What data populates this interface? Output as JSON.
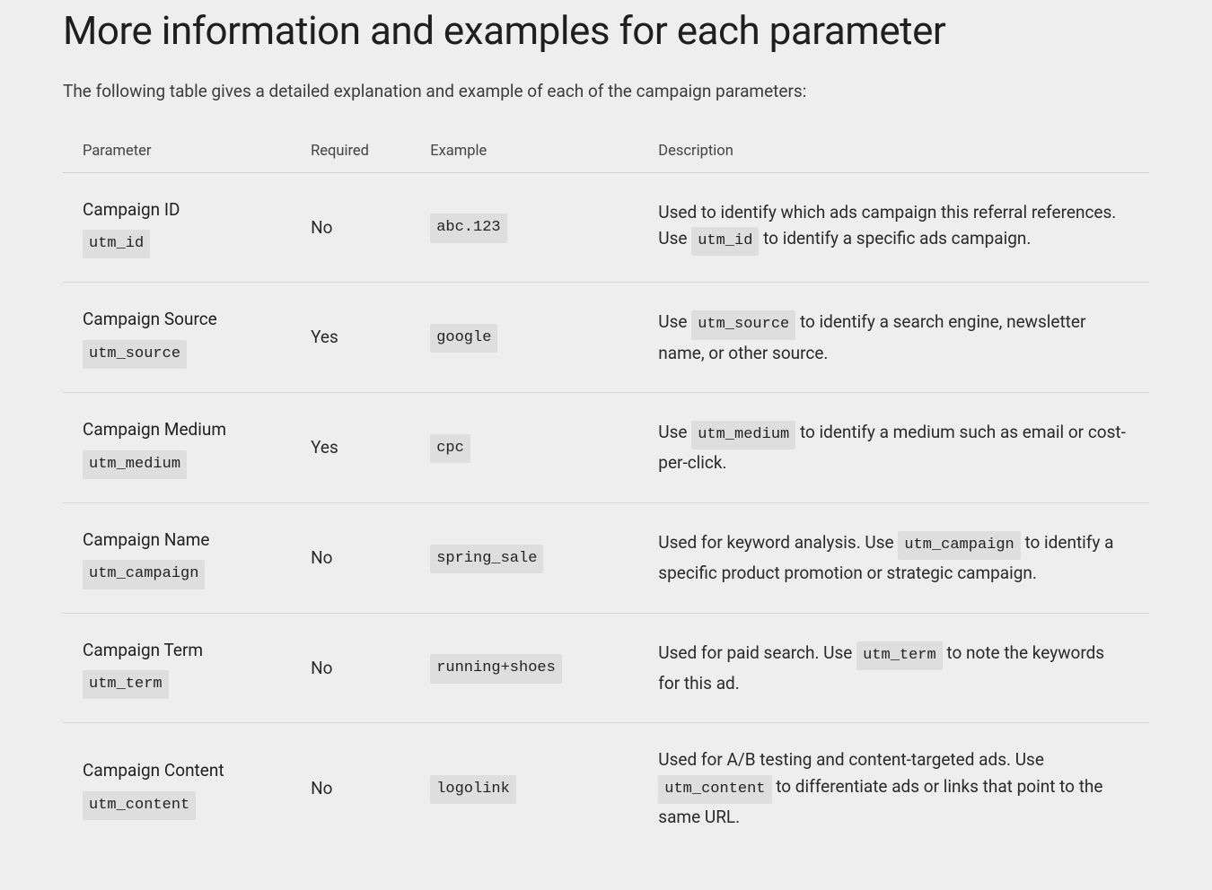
{
  "title": "More information and examples for each parameter",
  "intro": "The following table gives a detailed explanation and example of each of the campaign parameters:",
  "headers": {
    "parameter": "Parameter",
    "required": "Required",
    "example": "Example",
    "description": "Description"
  },
  "rows": [
    {
      "label": "Campaign ID",
      "code": "utm_id",
      "required": "No",
      "example": "abc.123",
      "desc_pre": "Used to identify which ads campaign this referral references. Use ",
      "desc_code": "utm_id",
      "desc_post": " to identify a specific ads campaign."
    },
    {
      "label": "Campaign Source",
      "code": "utm_source",
      "required": "Yes",
      "example": "google",
      "desc_pre": "Use ",
      "desc_code": "utm_source",
      "desc_post": " to identify a search engine, newsletter name, or other source."
    },
    {
      "label": "Campaign Medium",
      "code": "utm_medium",
      "required": "Yes",
      "example": "cpc",
      "desc_pre": "Use ",
      "desc_code": "utm_medium",
      "desc_post": " to identify a medium such as email or cost-per-click."
    },
    {
      "label": "Campaign Name",
      "code": "utm_campaign",
      "required": "No",
      "example": "spring_sale",
      "desc_pre": "Used for keyword analysis. Use ",
      "desc_code": "utm_campaign",
      "desc_post": " to identify a specific product promotion or strategic campaign."
    },
    {
      "label": "Campaign Term",
      "code": "utm_term",
      "required": "No",
      "example": "running+shoes",
      "desc_pre": "Used for paid search. Use ",
      "desc_code": "utm_term",
      "desc_post": " to note the keywords for this ad."
    },
    {
      "label": "Campaign Content",
      "code": "utm_content",
      "required": "No",
      "example": "logolink",
      "desc_pre": "Used for A/B testing and content-targeted ads. Use ",
      "desc_code": "utm_content",
      "desc_post": " to differentiate ads or links that point to the same URL."
    }
  ]
}
